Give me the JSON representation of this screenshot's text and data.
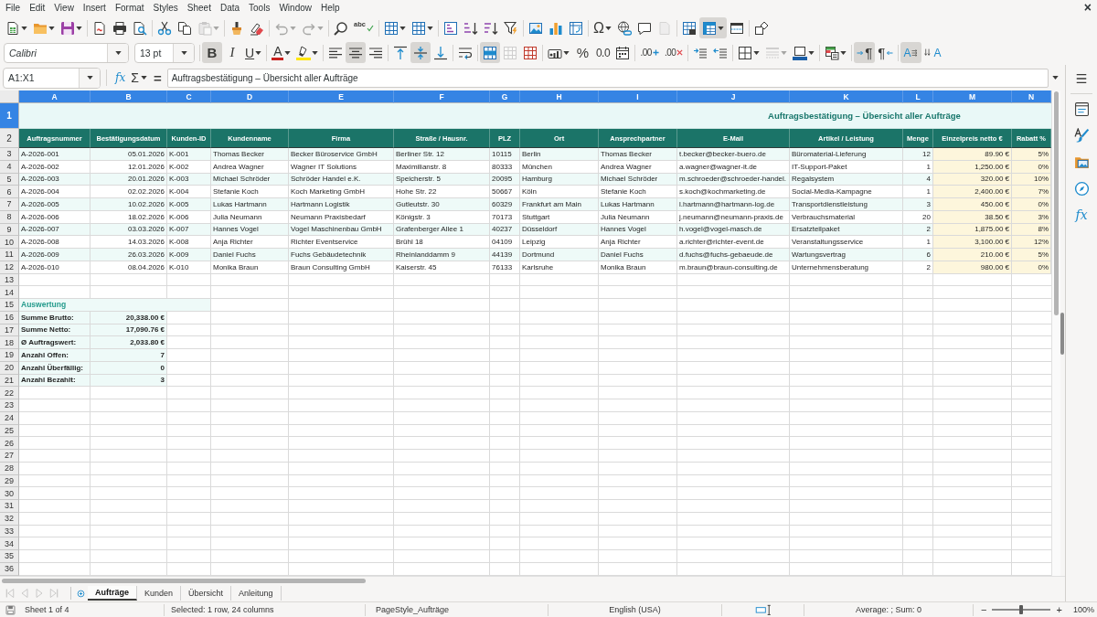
{
  "menu_bar": {
    "items": [
      "File",
      "Edit",
      "View",
      "Insert",
      "Format",
      "Styles",
      "Sheet",
      "Data",
      "Tools",
      "Window",
      "Help"
    ],
    "close": "×"
  },
  "standard_toolbar": [
    {
      "pressed": false,
      "disabled": false
    },
    {
      "pressed": false,
      "disabled": false
    },
    {
      "pressed": false,
      "disabled": false
    },
    {
      "pressed": false,
      "disabled": false
    },
    {
      "pressed": false,
      "disabled": false
    },
    {
      "pressed": false,
      "disabled": false
    },
    {
      "pressed": false,
      "disabled": false
    },
    {
      "pressed": false,
      "disabled": false
    },
    {
      "pressed": false,
      "disabled": true
    },
    {
      "pressed": false,
      "disabled": false
    },
    {
      "pressed": false,
      "disabled": false
    },
    {
      "pressed": false,
      "disabled": true
    },
    {
      "pressed": false,
      "disabled": true
    },
    {
      "pressed": false,
      "disabled": false
    },
    {
      "glyph": "abc",
      "pressed": false,
      "disabled": false
    },
    {
      "pressed": false,
      "disabled": false
    },
    {
      "pressed": false,
      "disabled": false
    },
    {
      "pressed": false,
      "disabled": false
    },
    {
      "pressed": false,
      "disabled": false
    },
    {
      "pressed": false,
      "disabled": false
    },
    {
      "pressed": false,
      "disabled": false
    },
    {
      "pressed": false,
      "disabled": false
    },
    {
      "pressed": false,
      "disabled": false
    },
    {
      "pressed": false,
      "disabled": false
    },
    {
      "glyph": "Ω",
      "pressed": false,
      "disabled": false
    },
    {
      "pressed": false,
      "disabled": false
    },
    {
      "pressed": false,
      "disabled": false
    },
    {
      "pressed": false,
      "disabled": true
    },
    {
      "pressed": false,
      "disabled": false
    },
    {
      "pressed": true,
      "disabled": false
    },
    {
      "pressed": false,
      "disabled": false
    },
    {
      "pressed": false,
      "disabled": false
    }
  ],
  "formatting_toolbar": {
    "font_name": "Calibri",
    "font_size": "13 pt",
    "buttons": [
      {
        "glyph": "B",
        "pressed": true,
        "disabled": false
      },
      {
        "glyph": "I",
        "pressed": false,
        "disabled": false
      },
      {
        "glyph": "U",
        "pressed": false,
        "disabled": false
      },
      {
        "glyph": "A",
        "pressed": false,
        "disabled": false
      },
      {
        "pressed": false,
        "disabled": false
      },
      {
        "pressed": false,
        "disabled": false
      },
      {
        "pressed": true,
        "disabled": false
      },
      {
        "pressed": false,
        "disabled": false
      },
      {
        "pressed": false,
        "disabled": false
      },
      {
        "pressed": true,
        "disabled": false
      },
      {
        "pressed": false,
        "disabled": false
      },
      {
        "pressed": false,
        "disabled": false
      },
      {
        "pressed": true,
        "disabled": false
      },
      {
        "pressed": false,
        "disabled": true
      },
      {
        "pressed": false,
        "disabled": false
      },
      {
        "pressed": false,
        "disabled": false
      },
      {
        "glyph": "%",
        "pressed": false,
        "disabled": false
      },
      {
        "glyph": "0.0",
        "pressed": false,
        "disabled": false
      },
      {
        "pressed": false,
        "disabled": false
      },
      {
        "glyph": ".00",
        "pressed": false,
        "disabled": false
      },
      {
        "glyph": ".00",
        "pressed": false,
        "disabled": false
      },
      {
        "pressed": false,
        "disabled": false
      },
      {
        "pressed": false,
        "disabled": false
      },
      {
        "pressed": false,
        "disabled": false
      },
      {
        "pressed": false,
        "disabled": true
      },
      {
        "pressed": false,
        "disabled": false
      },
      {
        "pressed": false,
        "disabled": false
      },
      {
        "glyph": "¶",
        "pressed": true,
        "disabled": false
      },
      {
        "glyph": "¶",
        "pressed": false,
        "disabled": false
      },
      {
        "glyph": "A",
        "pressed": true,
        "disabled": false
      },
      {
        "glyph": "A",
        "pressed": false,
        "disabled": false
      }
    ]
  },
  "formula_bar": {
    "name_box": "A1:X1",
    "function_wizard": "fx",
    "sum": "Σ",
    "formula_sign": "=",
    "content": "Auftragsbestätigung – Übersicht aller Aufträge"
  },
  "sidebar": {
    "functions_button": "fx"
  },
  "sheet": {
    "column_headers": [
      {
        "label": "A",
        "selected": true
      },
      {
        "label": "B",
        "selected": true
      },
      {
        "label": "C",
        "selected": true
      },
      {
        "label": "D",
        "selected": true
      },
      {
        "label": "E",
        "selected": true
      },
      {
        "label": "F",
        "selected": true
      },
      {
        "label": "G",
        "selected": true
      },
      {
        "label": "H",
        "selected": true
      },
      {
        "label": "I",
        "selected": true
      },
      {
        "label": "J",
        "selected": true
      },
      {
        "label": "K",
        "selected": true
      },
      {
        "label": "L",
        "selected": true
      },
      {
        "label": "M",
        "selected": true
      },
      {
        "label": "N",
        "selected": true
      }
    ],
    "row_headers": [
      {
        "label": "1",
        "selected": true
      },
      {
        "label": "2",
        "selected": false
      },
      {
        "label": "3",
        "selected": false
      },
      {
        "label": "4",
        "selected": false
      },
      {
        "label": "5",
        "selected": false
      },
      {
        "label": "6",
        "selected": false
      },
      {
        "label": "7",
        "selected": false
      },
      {
        "label": "8",
        "selected": false
      },
      {
        "label": "9",
        "selected": false
      },
      {
        "label": "10",
        "selected": false
      },
      {
        "label": "11",
        "selected": false
      },
      {
        "label": "12",
        "selected": false
      },
      {
        "label": "13",
        "selected": false
      },
      {
        "label": "14",
        "selected": false
      },
      {
        "label": "15",
        "selected": false
      },
      {
        "label": "16",
        "selected": false
      },
      {
        "label": "17",
        "selected": false
      },
      {
        "label": "18",
        "selected": false
      },
      {
        "label": "19",
        "selected": false
      },
      {
        "label": "20",
        "selected": false
      },
      {
        "label": "21",
        "selected": false
      },
      {
        "label": "22",
        "selected": false
      },
      {
        "label": "23",
        "selected": false
      },
      {
        "label": "24",
        "selected": false
      },
      {
        "label": "25",
        "selected": false
      },
      {
        "label": "26",
        "selected": false
      },
      {
        "label": "27",
        "selected": false
      },
      {
        "label": "28",
        "selected": false
      },
      {
        "label": "29",
        "selected": false
      },
      {
        "label": "30",
        "selected": false
      },
      {
        "label": "31",
        "selected": false
      },
      {
        "label": "32",
        "selected": false
      },
      {
        "label": "33",
        "selected": false
      },
      {
        "label": "34",
        "selected": false
      },
      {
        "label": "35",
        "selected": false
      },
      {
        "label": "36",
        "selected": false
      }
    ],
    "title": "Auftragsbestätigung – Übersicht aller Aufträge",
    "columns": [
      {
        "heading": "Auftragsnummer",
        "kind": "text"
      },
      {
        "heading": "Bestätigungsdatum",
        "kind": "date"
      },
      {
        "heading": "Kunden-ID",
        "kind": "text"
      },
      {
        "heading": "Kundenname",
        "kind": "text"
      },
      {
        "heading": "Firma",
        "kind": "text"
      },
      {
        "heading": "Straße / Hausnr.",
        "kind": "text"
      },
      {
        "heading": "PLZ",
        "kind": "text"
      },
      {
        "heading": "Ort",
        "kind": "text"
      },
      {
        "heading": "Ansprechpartner",
        "kind": "text"
      },
      {
        "heading": "E-Mail",
        "kind": "text"
      },
      {
        "heading": "Artikel / Leistung",
        "kind": "text"
      },
      {
        "heading": "Menge",
        "kind": "number"
      },
      {
        "heading": "Einzelpreis netto €",
        "kind": "money"
      },
      {
        "heading": "Rabatt %",
        "kind": "percent"
      }
    ],
    "rows": [
      [
        "A-2026-001",
        "05.01.2026",
        "K-001",
        "Thomas Becker",
        "Becker Büroservice GmbH",
        "Berliner Str. 12",
        "10115",
        "Berlin",
        "Thomas Becker",
        "t.becker@becker-buero.de",
        "Büromaterial-Lieferung",
        "12",
        "89.90 €",
        "5%"
      ],
      [
        "A-2026-002",
        "12.01.2026",
        "K-002",
        "Andrea Wagner",
        "Wagner IT Solutions",
        "Maximilianstr. 8",
        "80333",
        "München",
        "Andrea Wagner",
        "a.wagner@wagner-it.de",
        "IT-Support-Paket",
        "1",
        "1,250.00 €",
        "0%"
      ],
      [
        "A-2026-003",
        "20.01.2026",
        "K-003",
        "Michael Schröder",
        "Schröder Handel e.K.",
        "Speicherstr. 5",
        "20095",
        "Hamburg",
        "Michael Schröder",
        "m.schroeder@schroeder-handel.",
        "Regalsystem",
        "4",
        "320.00 €",
        "10%"
      ],
      [
        "A-2026-004",
        "02.02.2026",
        "K-004",
        "Stefanie Koch",
        "Koch Marketing GmbH",
        "Hohe Str. 22",
        "50667",
        "Köln",
        "Stefanie Koch",
        "s.koch@kochmarketing.de",
        "Social-Media-Kampagne",
        "1",
        "2,400.00 €",
        "7%"
      ],
      [
        "A-2026-005",
        "10.02.2026",
        "K-005",
        "Lukas Hartmann",
        "Hartmann Logistik",
        "Gutleutstr. 30",
        "60329",
        "Frankfurt am Main",
        "Lukas Hartmann",
        "l.hartmann@hartmann-log.de",
        "Transportdienstleistung",
        "3",
        "450.00 €",
        "0%"
      ],
      [
        "A-2026-006",
        "18.02.2026",
        "K-006",
        "Julia Neumann",
        "Neumann Praxisbedarf",
        "Königstr. 3",
        "70173",
        "Stuttgart",
        "Julia Neumann",
        "j.neumann@neumann-praxis.de",
        "Verbrauchsmaterial",
        "20",
        "38.50 €",
        "3%"
      ],
      [
        "A-2026-007",
        "03.03.2026",
        "K-007",
        "Hannes Vogel",
        "Vogel Maschinenbau GmbH",
        "Grafenberger Allee 1",
        "40237",
        "Düsseldorf",
        "Hannes Vogel",
        "h.vogel@vogel-masch.de",
        "Ersatzteilpaket",
        "2",
        "1,875.00 €",
        "8%"
      ],
      [
        "A-2026-008",
        "14.03.2026",
        "K-008",
        "Anja Richter",
        "Richter Eventservice",
        "Brühl 18",
        "04109",
        "Leipzig",
        "Anja Richter",
        "a.richter@richter-event.de",
        "Veranstaltungsservice",
        "1",
        "3,100.00 €",
        "12%"
      ],
      [
        "A-2026-009",
        "26.03.2026",
        "K-009",
        "Daniel Fuchs",
        "Fuchs Gebäudetechnik",
        "Rheinlanddamm 9",
        "44139",
        "Dortmund",
        "Daniel Fuchs",
        "d.fuchs@fuchs-gebaeude.de",
        "Wartungsvertrag",
        "6",
        "210.00 €",
        "5%"
      ],
      [
        "A-2026-010",
        "08.04.2026",
        "K-010",
        "Monika Braun",
        "Braun Consulting GmbH",
        "Kaiserstr. 45",
        "76133",
        "Karlsruhe",
        "Monika Braun",
        "m.braun@braun-consulting.de",
        "Unternehmensberatung",
        "2",
        "980.00 €",
        "0%"
      ]
    ],
    "summary": {
      "title": "Auswertung",
      "rows": [
        {
          "label": "Summe Brutto:",
          "value": "20,338.00 €"
        },
        {
          "label": "Summe Netto:",
          "value": "17,090.76 €"
        },
        {
          "label": "Ø Auftragswert:",
          "value": "2,033.80 €"
        },
        {
          "label": "Anzahl Offen:",
          "value": "7"
        },
        {
          "label": "Anzahl Überfällig:",
          "value": "0"
        },
        {
          "label": "Anzahl Bezahlt:",
          "value": "3"
        }
      ]
    }
  },
  "sheet_tabs": {
    "navigation_disabled": true,
    "tabs": [
      {
        "label": "Aufträge",
        "selected": true
      },
      {
        "label": "Kunden",
        "selected": false
      },
      {
        "label": "Übersicht",
        "selected": false
      },
      {
        "label": "Anleitung",
        "selected": false
      }
    ]
  },
  "status_bar": {
    "sheet_position": "Sheet 1 of 4",
    "selection": "Selected: 1 row, 24 columns",
    "page_style": "PageStyle_Aufträge",
    "language": "English (USA)",
    "statistics": "Average: ; Sum: 0",
    "zoom_out": "−",
    "zoom_in": "+",
    "zoom": {
      "level": 0.5
    },
    "zoom_value": "100%"
  }
}
